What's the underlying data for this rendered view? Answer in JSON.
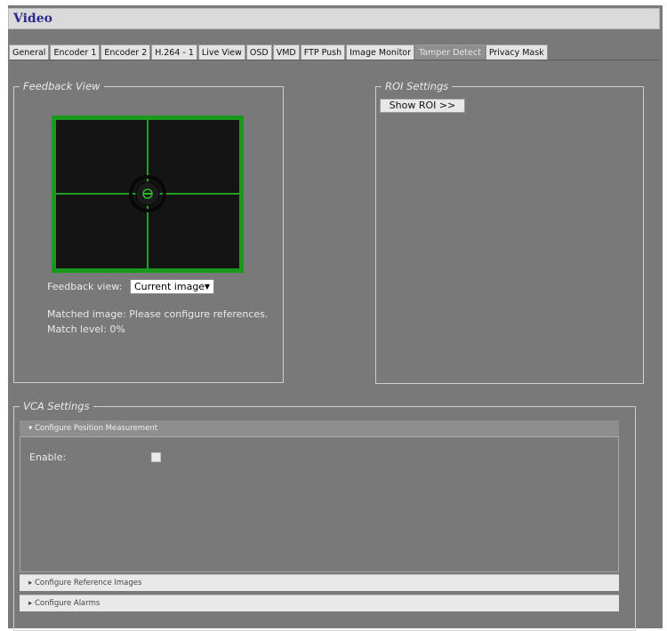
{
  "app": {
    "title": "Video"
  },
  "tabs": [
    "General",
    "Encoder 1",
    "Encoder 2",
    "H.264 - 1",
    "Live View",
    "OSD",
    "VMD",
    "FTP Push",
    "Image Monitor",
    "Tamper Detect",
    "Privacy Mask"
  ],
  "active_tab": "Tamper Detect",
  "feedback": {
    "legend": "Feedback View",
    "view_label": "Feedback view:",
    "view_value": "Current image",
    "matched_text": "Matched image: Please configure references.",
    "match_level_text": "Match level: 0%"
  },
  "roi": {
    "legend": "ROI Settings",
    "show_button": "Show ROI >>"
  },
  "vca": {
    "legend": "VCA Settings",
    "sections": [
      {
        "label": "Configure Position Measurement",
        "expanded": true
      },
      {
        "label": "Configure Reference Images",
        "expanded": false
      },
      {
        "label": "Configure Alarms",
        "expanded": false
      }
    ],
    "enable_label": "Enable:",
    "enable_checked": false
  },
  "colors": {
    "panel_bg": "#797979",
    "title_text": "#2b2a8c",
    "preview_border": "#1a9a1a",
    "crosshair": "#22a022",
    "preview_fill": "#141414"
  },
  "icons": {
    "expanded": "triangle-down-icon",
    "collapsed": "triangle-right-icon",
    "select": "chevron-down-icon"
  }
}
